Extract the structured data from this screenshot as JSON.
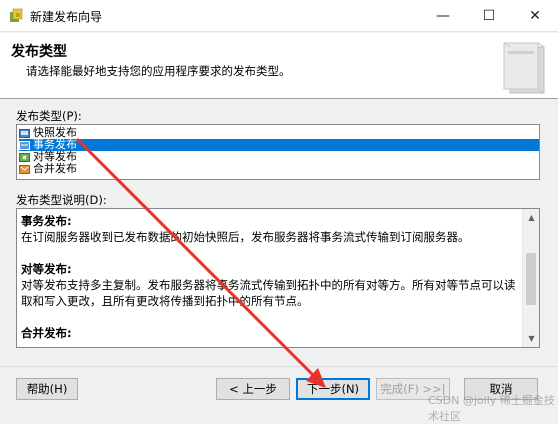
{
  "window": {
    "title": "新建发布向导",
    "minimize_glyph": "—",
    "maximize_glyph": "☐",
    "close_glyph": "✕"
  },
  "header": {
    "title": "发布类型",
    "description": "请选择能最好地支持您的应用程序要求的发布类型。"
  },
  "publication_types": {
    "label": "发布类型(P):",
    "items": [
      {
        "label": "快照发布",
        "icon": "snapshot-publication-icon",
        "selected": false
      },
      {
        "label": "事务发布",
        "icon": "transactional-publication-icon",
        "selected": true
      },
      {
        "label": "对等发布",
        "icon": "peer-to-peer-publication-icon",
        "selected": false
      },
      {
        "label": "合并发布",
        "icon": "merge-publication-icon",
        "selected": false
      }
    ]
  },
  "description_panel": {
    "label": "发布类型说明(D):",
    "blocks": [
      {
        "heading": "事务发布:",
        "body": "在订阅服务器收到已发布数据的初始快照后，发布服务器将事务流式传输到订阅服务器。"
      },
      {
        "heading": "对等发布:",
        "body": "对等发布支持多主复制。发布服务器将事务流式传输到拓扑中的所有对等方。所有对等节点可以读取和写入更改，且所有更改将传播到拓扑中的所有节点。"
      },
      {
        "heading": "合并发布:",
        "body": ""
      }
    ]
  },
  "buttons": {
    "help": "帮助(H)",
    "back": "< 上一步",
    "next": "下一步(N)",
    "finish": "完成(F) >>|",
    "cancel": "取消"
  },
  "watermark": "CSDN @jolly 稀土掘金技术社区",
  "colors": {
    "selection": "#0078d7",
    "annotation_arrow": "#e8322c"
  }
}
